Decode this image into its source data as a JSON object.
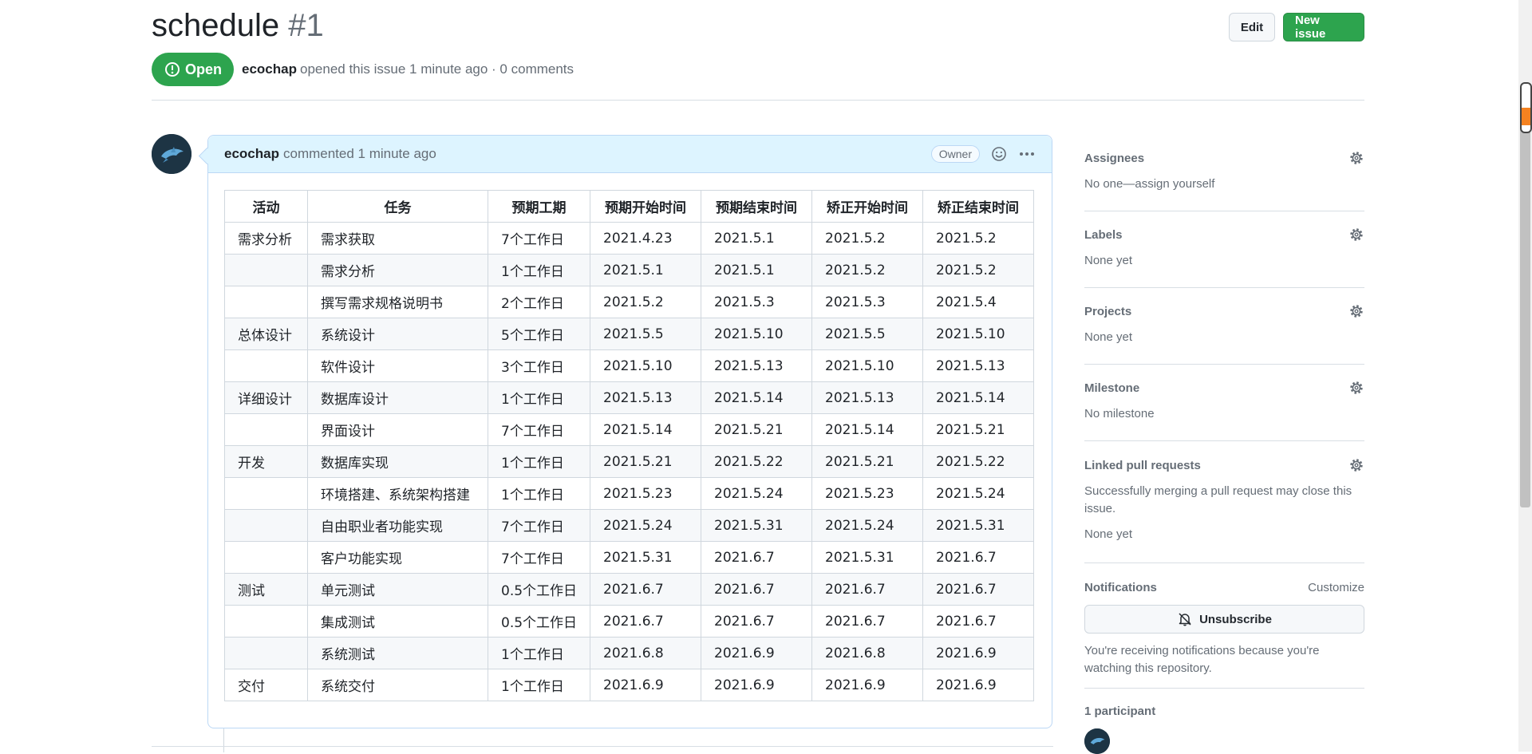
{
  "issue": {
    "title": "schedule",
    "number": "#1",
    "state": "Open",
    "author": "ecochap",
    "meta_text": "opened this issue 1 minute ago · 0 comments"
  },
  "header_actions": {
    "edit_label": "Edit",
    "new_issue_label": "New issue"
  },
  "comment": {
    "author": "ecochap",
    "meta": "commented 1 minute ago",
    "badge": "Owner"
  },
  "table": {
    "headers": [
      "活动",
      "任务",
      "预期工期",
      "预期开始时间",
      "预期结束时间",
      "矫正开始时间",
      "矫正结束时间"
    ],
    "rows": [
      [
        "需求分析",
        "需求获取",
        "7个工作日",
        "2021.4.23",
        "2021.5.1",
        "2021.5.2",
        "2021.5.2"
      ],
      [
        "",
        "需求分析",
        "1个工作日",
        "2021.5.1",
        "2021.5.1",
        "2021.5.2",
        "2021.5.2"
      ],
      [
        "",
        "撰写需求规格说明书",
        "2个工作日",
        "2021.5.2",
        "2021.5.3",
        "2021.5.3",
        "2021.5.4"
      ],
      [
        "总体设计",
        "系统设计",
        "5个工作日",
        "2021.5.5",
        "2021.5.10",
        "2021.5.5",
        "2021.5.10"
      ],
      [
        "",
        "软件设计",
        "3个工作日",
        "2021.5.10",
        "2021.5.13",
        "2021.5.10",
        "2021.5.13"
      ],
      [
        "详细设计",
        "数据库设计",
        "1个工作日",
        "2021.5.13",
        "2021.5.14",
        "2021.5.13",
        "2021.5.14"
      ],
      [
        "",
        "界面设计",
        "7个工作日",
        "2021.5.14",
        "2021.5.21",
        "2021.5.14",
        "2021.5.21"
      ],
      [
        "开发",
        "数据库实现",
        "1个工作日",
        "2021.5.21",
        "2021.5.22",
        "2021.5.21",
        "2021.5.22"
      ],
      [
        "",
        "环境搭建、系统架构搭建",
        "1个工作日",
        "2021.5.23",
        "2021.5.24",
        "2021.5.23",
        "2021.5.24"
      ],
      [
        "",
        "自由职业者功能实现",
        "7个工作日",
        "2021.5.24",
        "2021.5.31",
        "2021.5.24",
        "2021.5.31"
      ],
      [
        "",
        "客户功能实现",
        "7个工作日",
        "2021.5.31",
        "2021.6.7",
        "2021.5.31",
        "2021.6.7"
      ],
      [
        "测试",
        "单元测试",
        "0.5个工作日",
        "2021.6.7",
        "2021.6.7",
        "2021.6.7",
        "2021.6.7"
      ],
      [
        "",
        "集成测试",
        "0.5个工作日",
        "2021.6.7",
        "2021.6.7",
        "2021.6.7",
        "2021.6.7"
      ],
      [
        "",
        "系统测试",
        "1个工作日",
        "2021.6.8",
        "2021.6.9",
        "2021.6.8",
        "2021.6.9"
      ],
      [
        "交付",
        "系统交付",
        "1个工作日",
        "2021.6.9",
        "2021.6.9",
        "2021.6.9",
        "2021.6.9"
      ]
    ]
  },
  "sidebar": {
    "assignees": {
      "title": "Assignees",
      "value": "No one—assign yourself"
    },
    "labels": {
      "title": "Labels",
      "value": "None yet"
    },
    "projects": {
      "title": "Projects",
      "value": "None yet"
    },
    "milestone": {
      "title": "Milestone",
      "value": "No milestone"
    },
    "linked_prs": {
      "title": "Linked pull requests",
      "desc": "Successfully merging a pull request may close this issue.",
      "value": "None yet"
    },
    "notifications": {
      "title": "Notifications",
      "customize": "Customize",
      "unsubscribe": "Unsubscribe",
      "reason": "You're receiving notifications because you're watching this repository."
    },
    "participants": {
      "title": "1 participant"
    }
  },
  "colors": {
    "open_green": "#2da44e",
    "comment_header_bg": "#ddf4ff",
    "muted_text": "#656d76"
  }
}
